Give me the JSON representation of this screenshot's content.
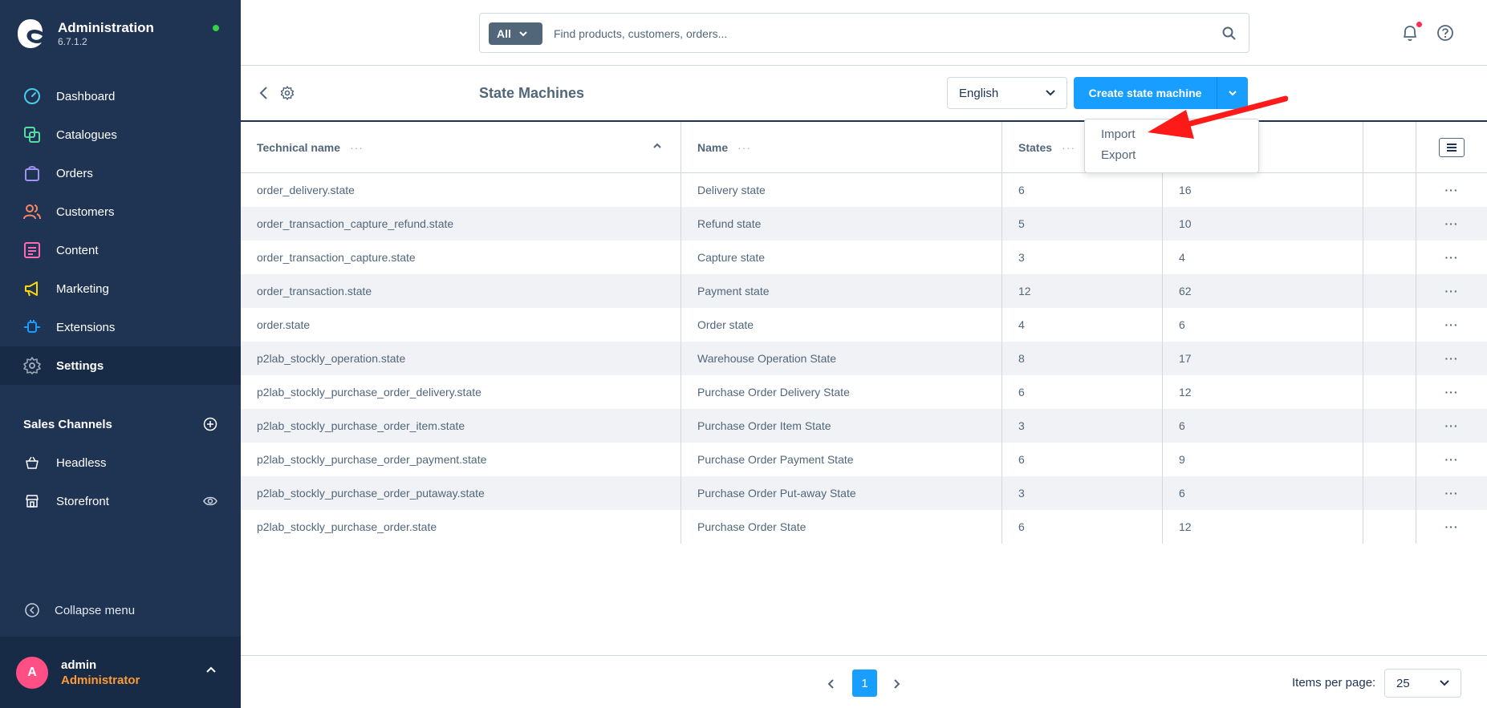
{
  "brand": {
    "title": "Administration",
    "version": "6.7.1.2"
  },
  "sidebar": {
    "items": [
      {
        "label": "Dashboard",
        "icon": "gauge-icon",
        "color": "#4ccbe8"
      },
      {
        "label": "Catalogues",
        "icon": "products-icon",
        "color": "#57d9a3"
      },
      {
        "label": "Orders",
        "icon": "shopping-bag-icon",
        "color": "#a092f0"
      },
      {
        "label": "Customers",
        "icon": "users-icon",
        "color": "#f88962"
      },
      {
        "label": "Content",
        "icon": "content-icon",
        "color": "#ff68b4"
      },
      {
        "label": "Marketing",
        "icon": "megaphone-icon",
        "color": "#ffd700"
      },
      {
        "label": "Extensions",
        "icon": "plug-icon",
        "color": "#189eff"
      },
      {
        "label": "Settings",
        "icon": "gear-icon",
        "color": "#9aa8b5"
      }
    ],
    "sales_channels_title": "Sales Channels",
    "sales_channels": [
      {
        "label": "Headless"
      },
      {
        "label": "Storefront"
      }
    ],
    "collapse_label": "Collapse menu"
  },
  "user": {
    "initial": "A",
    "name": "admin",
    "role": "Administrator"
  },
  "search": {
    "type_label": "All",
    "placeholder": "Find products, customers, orders..."
  },
  "page": {
    "title": "State Machines",
    "language": "English",
    "create_label": "Create state machine",
    "dropdown": [
      "Import",
      "Export"
    ]
  },
  "table": {
    "headers": [
      "Technical name",
      "Name",
      "States",
      "",
      "",
      ""
    ],
    "rows": [
      [
        "order_delivery.state",
        "Delivery state",
        "6",
        "16"
      ],
      [
        "order_transaction_capture_refund.state",
        "Refund state",
        "5",
        "10"
      ],
      [
        "order_transaction_capture.state",
        "Capture state",
        "3",
        "4"
      ],
      [
        "order_transaction.state",
        "Payment state",
        "12",
        "62"
      ],
      [
        "order.state",
        "Order state",
        "4",
        "6"
      ],
      [
        "p2lab_stockly_operation.state",
        "Warehouse Operation State",
        "8",
        "17"
      ],
      [
        "p2lab_stockly_purchase_order_delivery.state",
        "Purchase Order Delivery State",
        "6",
        "12"
      ],
      [
        "p2lab_stockly_purchase_order_item.state",
        "Purchase Order Item State",
        "3",
        "6"
      ],
      [
        "p2lab_stockly_purchase_order_payment.state",
        "Purchase Order Payment State",
        "6",
        "9"
      ],
      [
        "p2lab_stockly_purchase_order_putaway.state",
        "Purchase Order Put-away State",
        "3",
        "6"
      ],
      [
        "p2lab_stockly_purchase_order.state",
        "Purchase Order State",
        "6",
        "12"
      ]
    ]
  },
  "pagination": {
    "current_page": "1",
    "items_per_page_label": "Items per page:",
    "items_per_page": "25"
  }
}
